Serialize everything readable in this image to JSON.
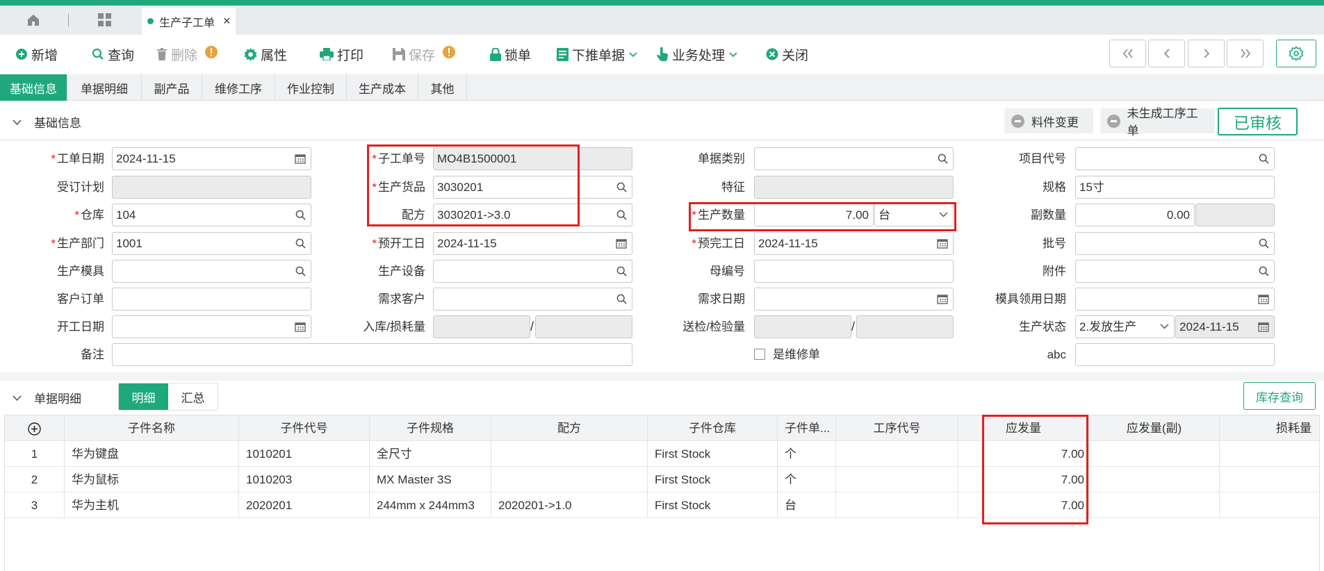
{
  "tabbar": {
    "doc_tab": "生产子工单",
    "close": "×"
  },
  "toolbar": {
    "new": "新增",
    "query": "查询",
    "delete": "删除",
    "attributes": "属性",
    "print": "打印",
    "save": "保存",
    "lock": "锁单",
    "push_down": "下推单据",
    "business": "业务处理",
    "close": "关闭"
  },
  "subtabs": [
    "基础信息",
    "单据明细",
    "副产品",
    "维修工序",
    "作业控制",
    "生产成本",
    "其他"
  ],
  "basic_section": {
    "title": "基础信息",
    "material_change": "料件变更",
    "no_process_order": "未生成工序工单",
    "status_badge": "已审核"
  },
  "labels": {
    "work_date": "工单日期",
    "sub_order_no": "子工单号",
    "doc_category": "单据类别",
    "project_code": "项目代号",
    "order_plan": "受订计划",
    "product": "生产货品",
    "feature": "特征",
    "spec": "规格",
    "warehouse": "仓库",
    "formula": "配方",
    "prod_qty": "生产数量",
    "sub_qty": "副数量",
    "dept": "生产部门",
    "plan_start": "预开工日",
    "plan_end": "预完工日",
    "batch": "批号",
    "mold": "生产模具",
    "equipment": "生产设备",
    "parent_no": "母编号",
    "attachment": "附件",
    "customer_order": "客户订单",
    "demand_customer": "需求客户",
    "demand_date": "需求日期",
    "mold_date": "模具领用日期",
    "start_date": "开工日期",
    "in_loss": "入库/损耗量",
    "inspect": "送检/检验量",
    "prod_status": "生产状态",
    "remark": "备注",
    "is_repair": "是维修单",
    "abc": "abc"
  },
  "values": {
    "work_date": "2024-11-15",
    "sub_order_no": "MO4B1500001",
    "product": "3030201",
    "spec": "15寸",
    "warehouse": "104",
    "formula": "3030201->3.0",
    "prod_qty": "7.00",
    "prod_unit": "台",
    "sub_qty": "0.00",
    "dept": "1001",
    "plan_start": "2024-11-15",
    "plan_end": "2024-11-15",
    "prod_status": "2.发放生产",
    "status_date": "2024-11-15",
    "slash": "/"
  },
  "detail_section": {
    "title": "单据明细",
    "tab_detail": "明细",
    "tab_summary": "汇总",
    "stock_query": "库存查询"
  },
  "grid": {
    "headers": [
      "子件名称",
      "子件代号",
      "子件规格",
      "配方",
      "子件仓库",
      "子件单...",
      "工序代号",
      "应发量",
      "应发量(副)",
      "损耗量"
    ],
    "rows": [
      {
        "no": "1",
        "name": "华为键盘",
        "code": "1010201",
        "spec": "全尺寸",
        "formula": "",
        "wh": "First Stock",
        "unit": "个",
        "proc": "",
        "qty": "7.00"
      },
      {
        "no": "2",
        "name": "华为鼠标",
        "code": "1010203",
        "spec": "MX Master 3S",
        "formula": "",
        "wh": "First Stock",
        "unit": "个",
        "proc": "",
        "qty": "7.00"
      },
      {
        "no": "3",
        "name": "华为主机",
        "code": "2020201",
        "spec": "244mm x 244mm3",
        "formula": "2020201->1.0",
        "wh": "First Stock",
        "unit": "台",
        "proc": "",
        "qty": "7.00"
      }
    ]
  },
  "colors": {
    "accent": "#1fa87c",
    "highlight": "#e0201f",
    "required": "#e02020",
    "warning": "#e6a23c"
  }
}
